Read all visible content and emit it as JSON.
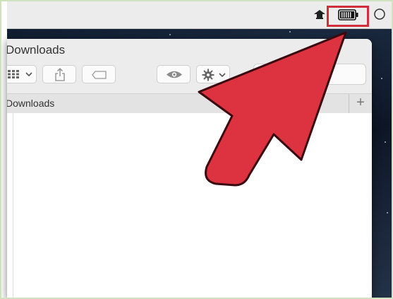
{
  "window": {
    "title": "Downloads",
    "tab_label": "Downloads",
    "tab_add_symbol": "+"
  },
  "menubar": {
    "icons": [
      "airdrop-icon",
      "battery-icon",
      "spotlight-icon"
    ]
  },
  "toolbar": {
    "icons": [
      "view-options-icon",
      "chevron-down-icon",
      "share-icon",
      "tag-icon",
      "quick-look-eye-icon",
      "gear-icon",
      "chevron-down-icon"
    ]
  },
  "annotation": {
    "highlight_color": "#d12e3c",
    "arrow_color": "#dd3340"
  },
  "colors": {
    "menubar": "#ececec",
    "window_chrome": "#ececec",
    "tab_bar": "#e3e3e3",
    "desktop": "#1b2a40"
  }
}
